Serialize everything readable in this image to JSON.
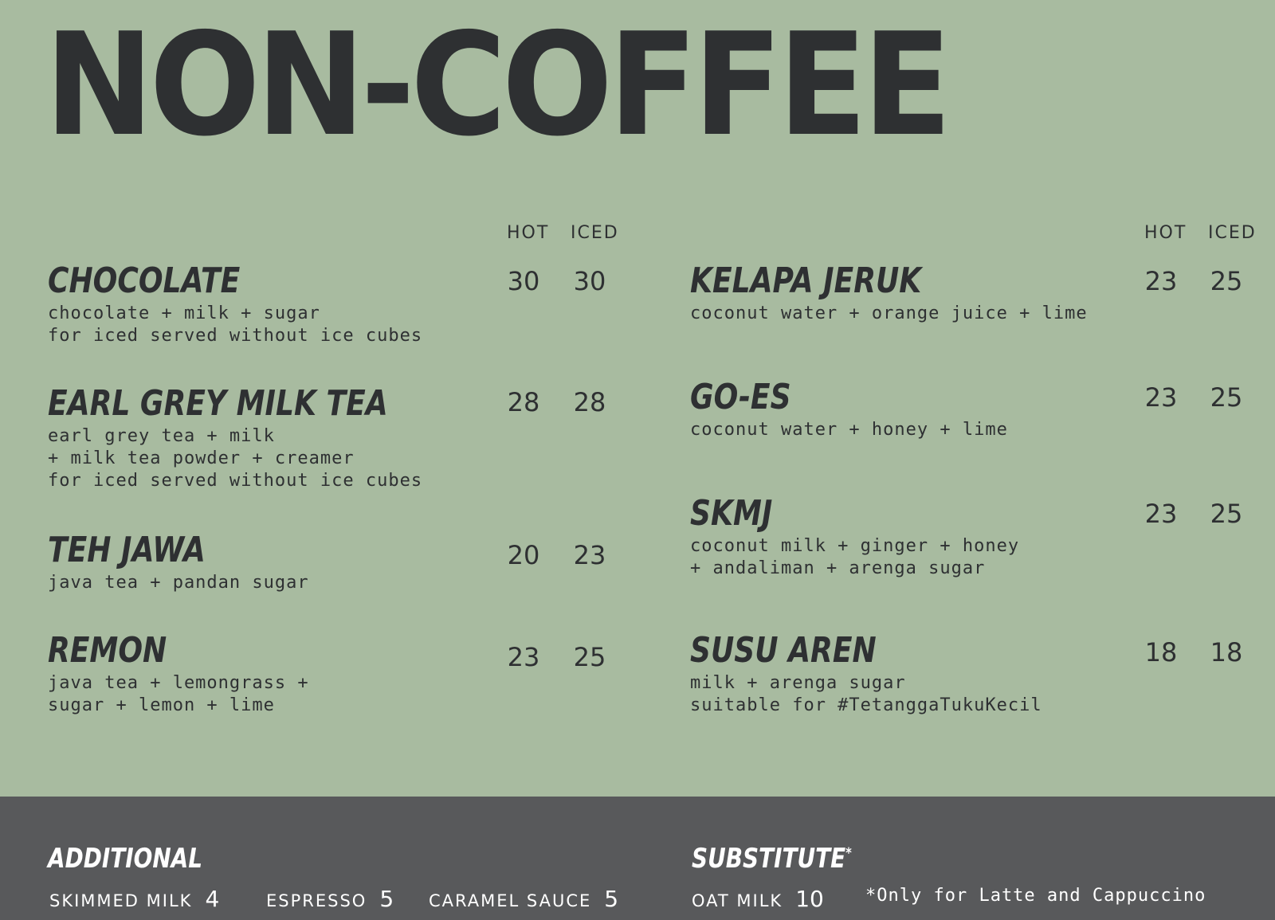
{
  "title": "NON-COFFEE",
  "columns": {
    "hot": "HOT",
    "iced": "ICED"
  },
  "left_items": [
    {
      "name": "CHOCOLATE",
      "desc": [
        "chocolate + milk + sugar",
        "for iced served without ice cubes"
      ],
      "hot": "30",
      "iced": "30"
    },
    {
      "name": "EARL GREY MILK TEA",
      "desc": [
        "earl grey tea + milk",
        "+ milk tea powder + creamer",
        "for iced served without ice cubes"
      ],
      "hot": "28",
      "iced": "28"
    },
    {
      "name": "TEH JAWA",
      "desc": [
        "java tea + pandan sugar"
      ],
      "hot": "20",
      "iced": "23"
    },
    {
      "name": "REMON",
      "desc": [
        "java tea + lemongrass +",
        "sugar + lemon + lime"
      ],
      "hot": "23",
      "iced": "25"
    }
  ],
  "right_items": [
    {
      "name": "KELAPA JERUK",
      "desc": [
        "coconut water + orange juice + lime"
      ],
      "hot": "23",
      "iced": "25"
    },
    {
      "name": "GO-ES",
      "desc": [
        "coconut water + honey + lime"
      ],
      "hot": "23",
      "iced": "25"
    },
    {
      "name": "SKMJ",
      "desc": [
        "coconut milk + ginger + honey",
        "+ andaliman + arenga sugar"
      ],
      "hot": "23",
      "iced": "25"
    },
    {
      "name": "SUSU AREN",
      "desc": [
        "milk + arenga sugar",
        "suitable for #TetanggaTukuKecil"
      ],
      "hot": "18",
      "iced": "18"
    }
  ],
  "footer": {
    "additional_title": "ADDITIONAL",
    "additional": [
      {
        "name": "SKIMMED MILK",
        "price": "4"
      },
      {
        "name": "ESPRESSO",
        "price": "5"
      },
      {
        "name": "CARAMEL SAUCE",
        "price": "5"
      }
    ],
    "substitute_title": "SUBSTITUTE",
    "substitute_mark": "*",
    "substitute": [
      {
        "name": "OAT MILK",
        "price": "10"
      }
    ],
    "note": "*Only for Latte and Cappuccino"
  },
  "colors": {
    "background": "#a8bba0",
    "footer": "#58595b",
    "text": "#2e3032"
  }
}
